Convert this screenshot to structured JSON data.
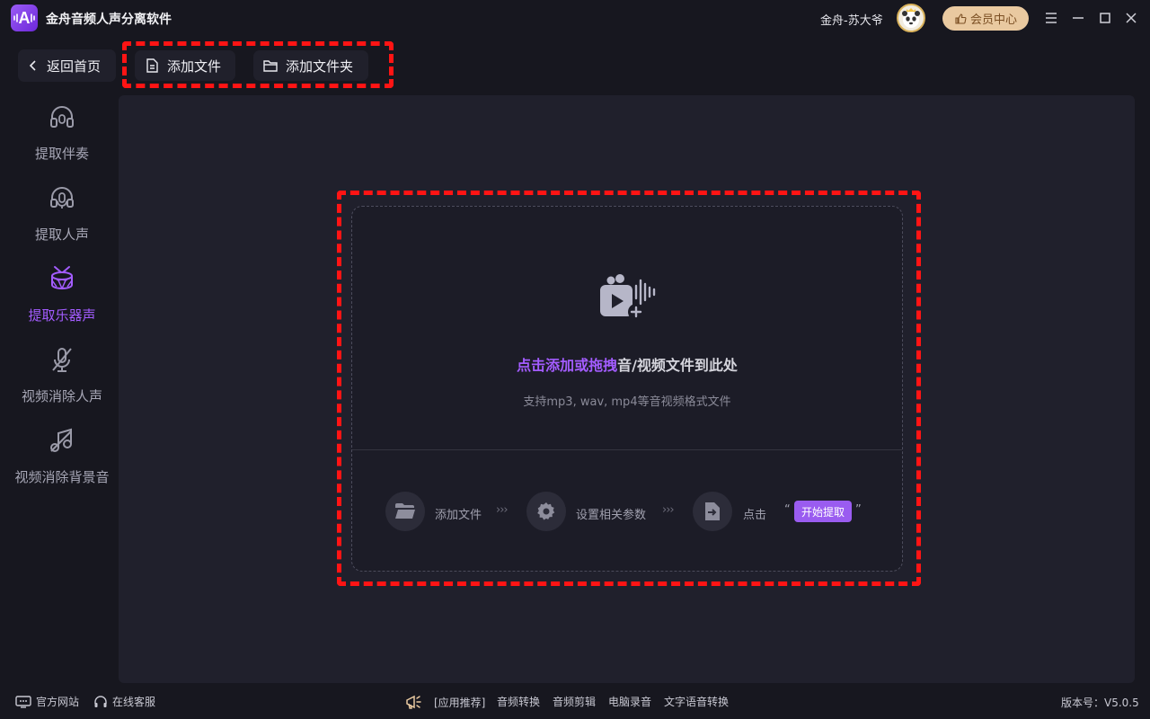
{
  "app": {
    "title": "金舟音频人声分离软件",
    "logo_letter": "A"
  },
  "header": {
    "username": "金舟-苏大爷",
    "vip_label": "会员中心"
  },
  "toolbar": {
    "back_label": "返回首页",
    "add_file_label": "添加文件",
    "add_folder_label": "添加文件夹"
  },
  "sidebar": {
    "items": [
      {
        "label": "提取伴奏",
        "icon": "headphone-icon",
        "active": false
      },
      {
        "label": "提取人声",
        "icon": "microphone-icon",
        "active": false
      },
      {
        "label": "提取乐器声",
        "icon": "drum-icon",
        "active": true
      },
      {
        "label": "视频消除人声",
        "icon": "mic-off-icon",
        "active": false
      },
      {
        "label": "视频消除背景音",
        "icon": "music-off-icon",
        "active": false
      }
    ]
  },
  "dropzone": {
    "title_highlight": "点击添加或拖拽",
    "title_rest": "音/视频文件到此处",
    "subtitle": "支持mp3, wav, mp4等音视频格式文件",
    "steps": [
      {
        "label": "添加文件",
        "icon": "folder-icon"
      },
      {
        "label": "设置相关参数",
        "icon": "gear-icon"
      },
      {
        "label": "点击",
        "icon": "export-icon"
      }
    ],
    "arrow": "›››",
    "quote_open": "“",
    "quote_close": "”",
    "start_label": "开始提取"
  },
  "statusbar": {
    "website": "官方网站",
    "support": "在线客服",
    "recommend": "[应用推荐]",
    "links": [
      "音频转换",
      "音频剪辑",
      "电脑录音",
      "文字语音转换"
    ],
    "version": "版本号：V5.0.5"
  },
  "colors": {
    "accent": "#a35cff",
    "highlight_frame": "#ff1414",
    "vip": "#e9c9a0",
    "background": "#17171f"
  }
}
